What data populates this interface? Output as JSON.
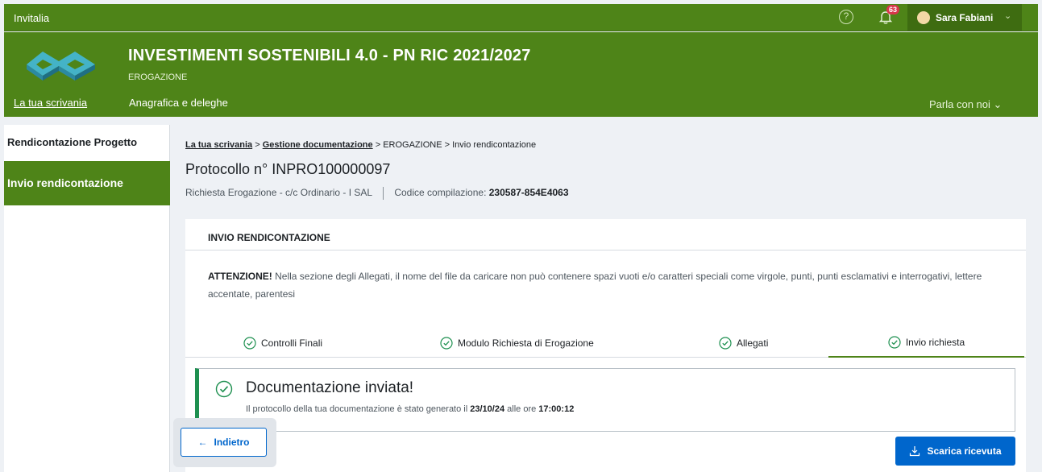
{
  "topbar": {
    "brand": "Invitalia",
    "notifications_count": "63",
    "user_name": "Sara Fabiani",
    "icons": {
      "help": "help-icon",
      "bell": "bell-icon",
      "avatar": "avatar-icon",
      "caret": "chevron-down-icon"
    }
  },
  "header": {
    "title": "INVESTIMENTI SOSTENIBILI 4.0 - PN RIC 2021/2027",
    "subtitle": "EROGAZIONE",
    "nav": {
      "desk": "La tua scrivania",
      "registry": "Anagrafica e deleghe",
      "chat": "Parla con noi"
    }
  },
  "sidebar": {
    "items": [
      {
        "label": "Rendicontazione Progetto",
        "active": false
      },
      {
        "label": "Invio rendicontazione",
        "active": true
      }
    ]
  },
  "breadcrumb": {
    "items": [
      "La tua scrivania",
      "Gestione documentazione",
      "EROGAZIONE",
      "Invio rendicontazione"
    ],
    "separator": ">"
  },
  "protocol": {
    "title": "Protocollo n° INPRO100000097",
    "request": "Richiesta Erogazione - c/c Ordinario  -  I SAL",
    "code_label": "Codice compilazione:",
    "code_value": "230587-854E4063"
  },
  "card": {
    "heading": "INVIO RENDICONTAZIONE",
    "warning_label": "ATTENZIONE!",
    "warning_text": "Nella sezione degli Allegati, il nome del file da caricare non può contenere spazi vuoti e/o caratteri speciali come virgole, punti, punti esclamativi e interrogativi, lettere accentate, parentesi"
  },
  "tabs": [
    {
      "label": "Controlli Finali",
      "active": false
    },
    {
      "label": "Modulo Richiesta di Erogazione",
      "active": false
    },
    {
      "label": "Allegati",
      "active": false
    },
    {
      "label": "Invio richiesta",
      "active": true
    }
  ],
  "success": {
    "title": "Documentazione inviata!",
    "text_prefix": "Il protocollo della tua documentazione è stato generato il",
    "date": "23/10/24",
    "text_middle": "alle ore",
    "time": "17:00:12"
  },
  "buttons": {
    "back": "Indietro",
    "download": "Scarica ricevuta"
  },
  "colors": {
    "brand_green": "#4e8418",
    "success_green": "#1e9050",
    "primary_blue": "#0066cc",
    "badge_red": "#d9364c"
  }
}
